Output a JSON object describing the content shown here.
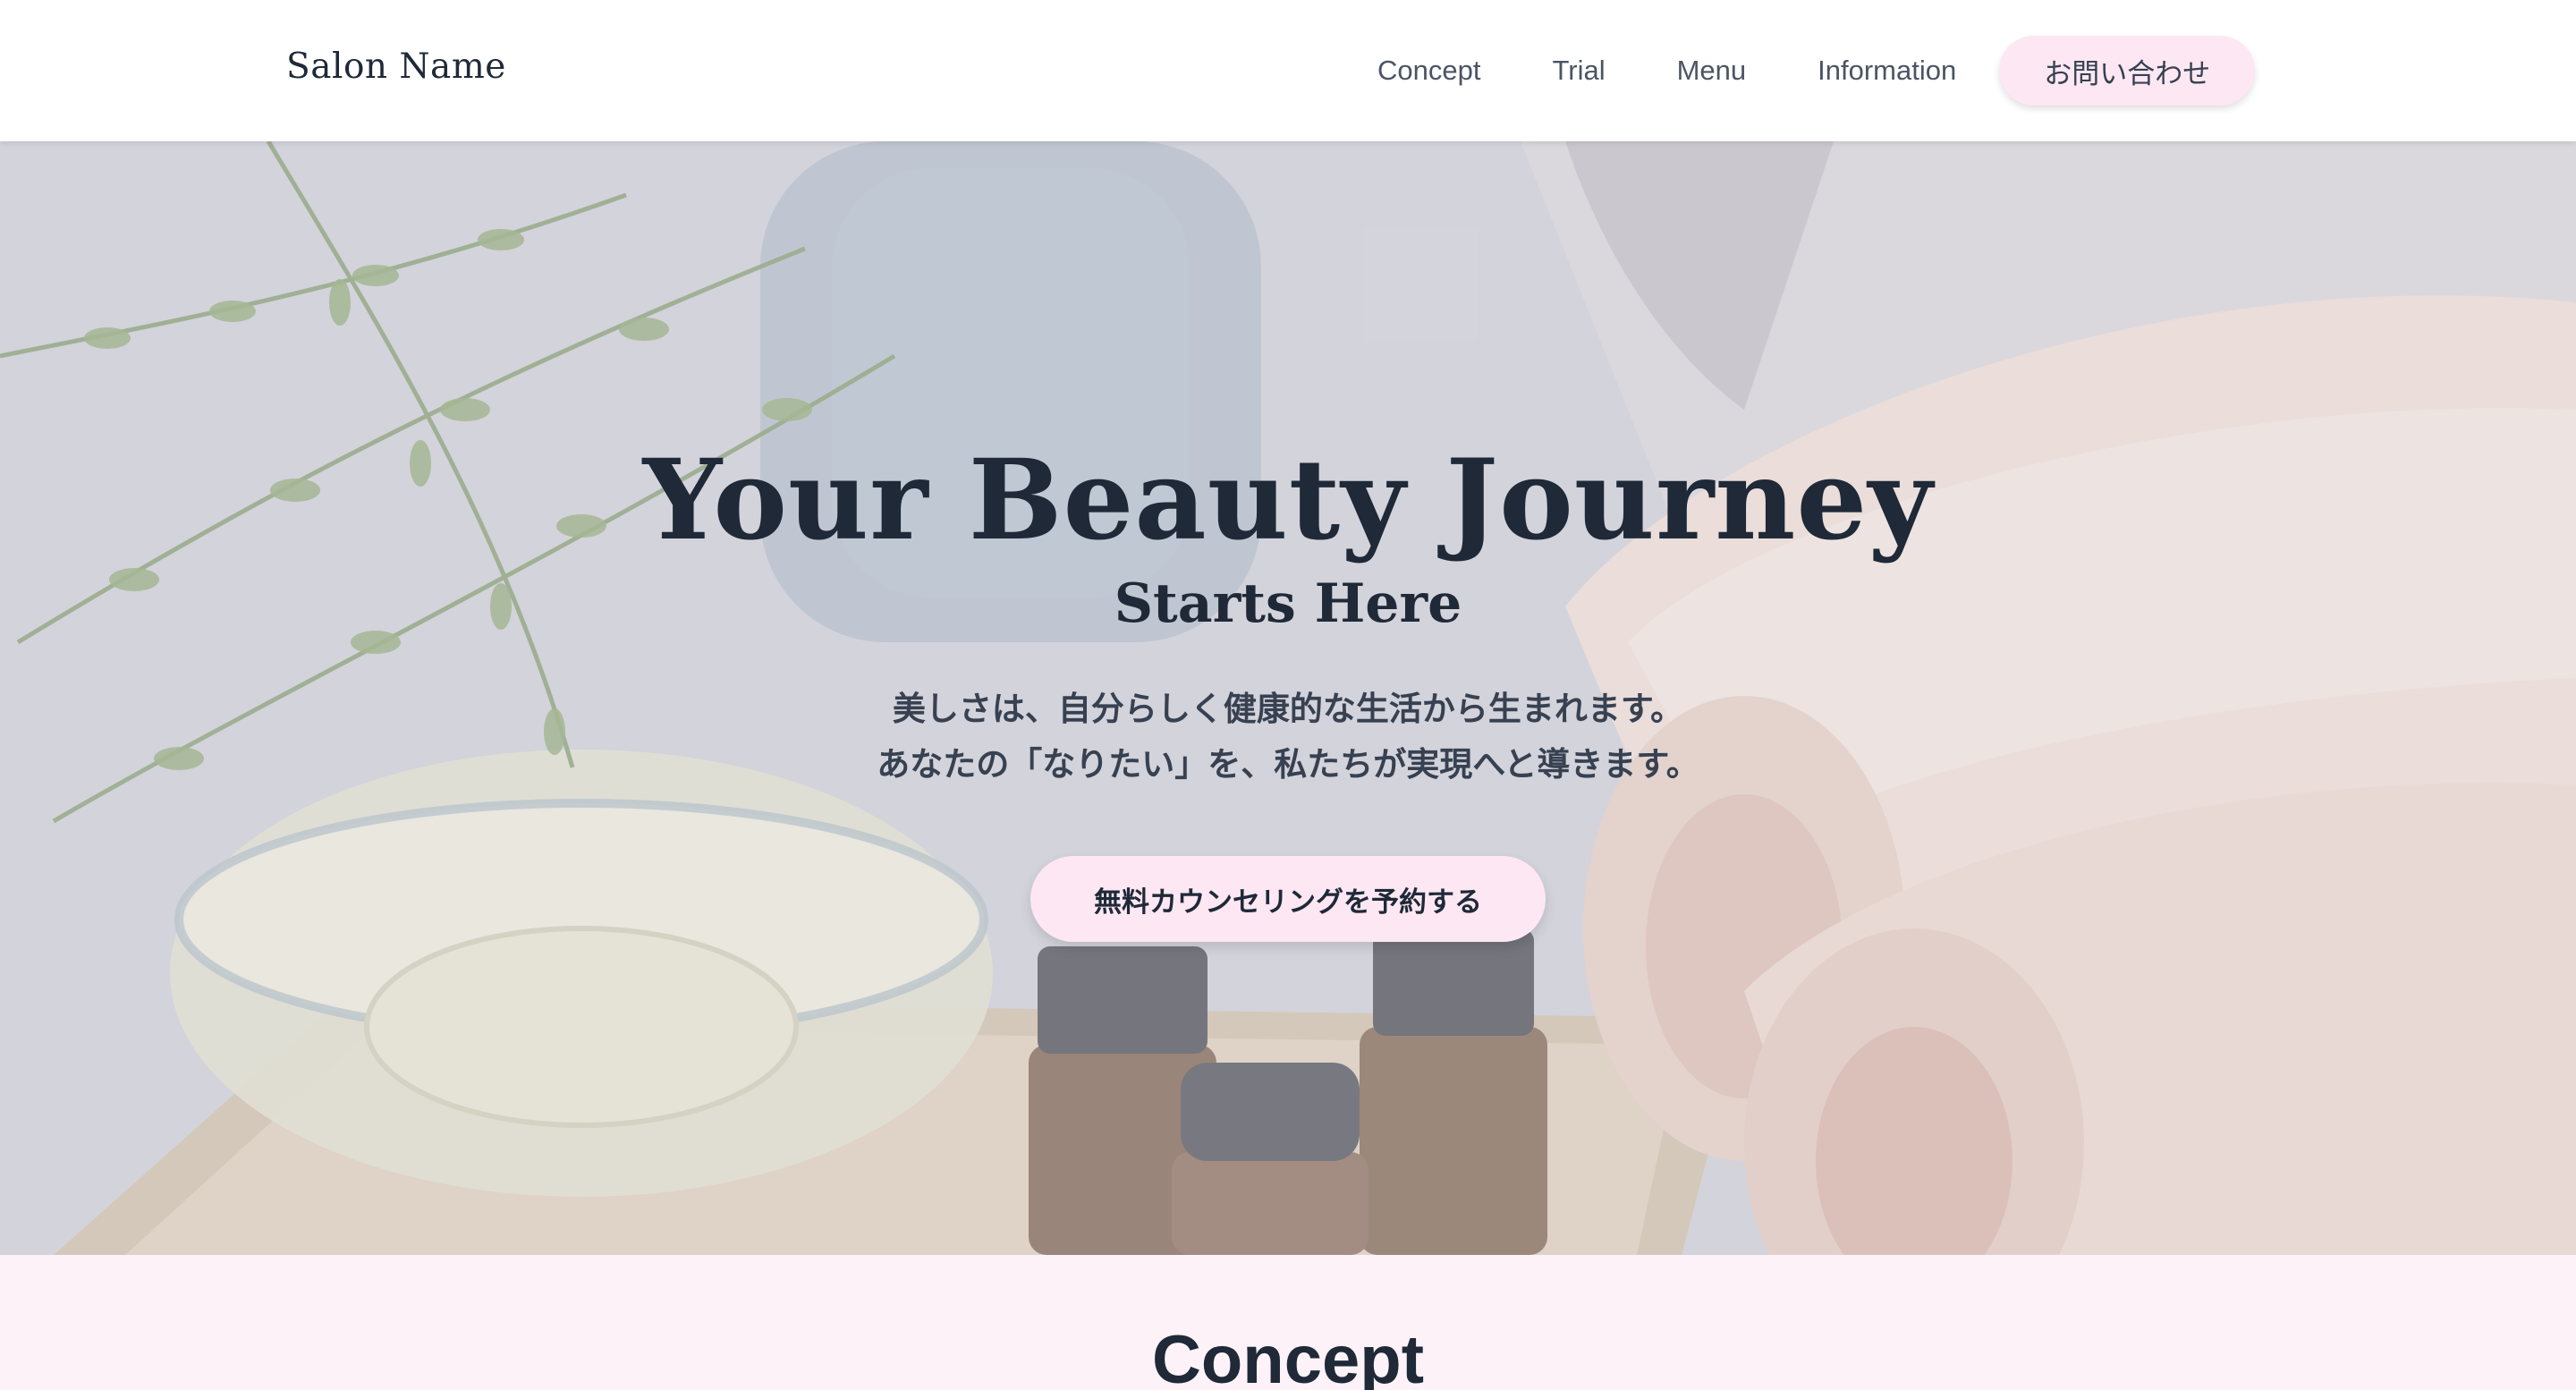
{
  "header": {
    "logo": "Salon Name",
    "nav": [
      {
        "label": "Concept"
      },
      {
        "label": "Trial"
      },
      {
        "label": "Menu"
      },
      {
        "label": "Information"
      }
    ],
    "contact_label": "お問い合わせ"
  },
  "hero": {
    "title": "Your Beauty Journey",
    "subtitle": "Starts Here",
    "lines": [
      "美しさは、自分らしく健康的な生活から生まれます。",
      "あなたの「なりたい」を、私たちが実現へと導きます。"
    ],
    "cta_label": "無料カウンセリングを予約する"
  },
  "concept": {
    "title": "Concept"
  },
  "colors": {
    "accent_pink": "#fce7f3",
    "section_bg": "#fdf2f8",
    "text_dark": "#1f2937",
    "nav_text": "#4b5563"
  }
}
